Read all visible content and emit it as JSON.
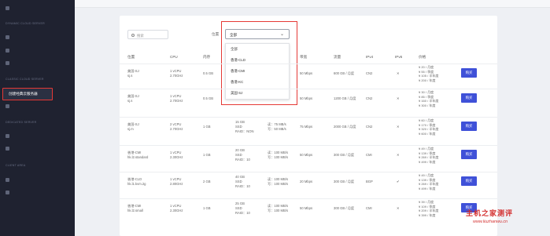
{
  "sidebar": {
    "active_item": "创建经典云服务器",
    "sections": [
      "DYNAMIC CLOUD SERVER",
      "CLASSIC CLOUD SERVER",
      "DEDICATED SERVER",
      "CLIENT AREA"
    ]
  },
  "header": {},
  "filters": {
    "search_placeholder": "搜索",
    "location_label": "位置",
    "location_value": "全部",
    "location_options": [
      "全部",
      "香港-CLD",
      "香港-CMI",
      "香港-KC",
      "美国-SJ"
    ]
  },
  "table": {
    "columns": [
      "位置",
      "CPU",
      "内存",
      "带宽",
      "流量",
      "IPv4",
      "IPv6",
      "价格"
    ],
    "buy_label": "购买",
    "rows": [
      {
        "loc": [
          "美国-SJ",
          "sj.s"
        ],
        "cpu": [
          "1 vCPU",
          "2.70GHz"
        ],
        "mem": "0.5 GB",
        "bw": "50 Mbps",
        "traffic": "600 GB / 月度",
        "ipv4": "CN2",
        "ipv6": "✕",
        "price": [
          "¥ 20 / 月度",
          "¥ 55 / 季度",
          "¥ 105 / 半年度",
          "¥ 200 / 年度"
        ]
      },
      {
        "loc": [
          "美国-SJ",
          "sj.s"
        ],
        "cpu": [
          "1 vCPU",
          "2.70GHz"
        ],
        "mem": "0.5 GB",
        "bw": "50 Mbps",
        "traffic": "1200 GB / 月度",
        "ipv4": "CN2",
        "ipv6": "✕",
        "price": [
          "¥ 30 / 月度",
          "¥ 85 / 季度",
          "¥ 160 / 半年度",
          "¥ 300 / 年度"
        ]
      },
      {
        "loc": [
          "美国-SJ",
          "sj.m"
        ],
        "cpu": [
          "2 vCPU",
          "2.70GHz"
        ],
        "mem": "1 GB",
        "disk": [
          "15 GB",
          "SSD",
          "RAID：NON"
        ],
        "io": [
          "读：75 MB/s",
          "写：50 MB/s"
        ],
        "bw": "75 Mbps",
        "traffic": "2000 GB / 月度",
        "ipv4": "CN2",
        "ipv6": "✕",
        "price": [
          "¥ 60 / 月度",
          "¥ 170 / 季度",
          "¥ 320 / 半年度",
          "¥ 600 / 年度"
        ]
      },
      {
        "loc": [
          "香港-CMI",
          "hk.l2.standard"
        ],
        "cpu": [
          "1 vCPU",
          "2.30GHz"
        ],
        "mem": "1 GB",
        "disk": [
          "20 GB",
          "SSD",
          "RAID：10"
        ],
        "io": [
          "读：100 MB/s",
          "写：100 MB/s"
        ],
        "bw": "50 Mbps",
        "traffic": "300 GB / 月度",
        "ipv4": "CMI",
        "ipv6": "✕",
        "price": [
          "¥ 49 / 月度",
          "¥ 139 / 季度",
          "¥ 269 / 半年度",
          "¥ 499 / 年度"
        ]
      },
      {
        "loc": [
          "香港-CLD",
          "hk.l1.kvm.2g"
        ],
        "cpu": [
          "1 vCPU",
          "2.80GHz"
        ],
        "mem": "2 GB",
        "disk": [
          "40 GB",
          "SSD",
          "RAID：10"
        ],
        "io": [
          "读：100 MB/s",
          "写：100 MB/s"
        ],
        "bw": "20 Mbps",
        "traffic": "300 GB / 月度",
        "ipv4": "BGP",
        "ipv6": "✔",
        "price": [
          "¥ 49 / 月度",
          "¥ 139 / 季度",
          "¥ 269 / 半年度",
          "¥ 499 / 年度"
        ]
      },
      {
        "loc": [
          "香港-CMI",
          "hk.l2.small"
        ],
        "cpu": [
          "1 vCPU",
          "2.30GHz"
        ],
        "mem": "1 GB",
        "disk": [
          "25 GB",
          "SSD",
          "RAID：10"
        ],
        "io": [
          "读：100 MB/s",
          "写：100 MB/s"
        ],
        "bw": "50 Mbps",
        "traffic": "300 GB / 月度",
        "ipv4": "CMI",
        "ipv6": "✕",
        "price": [
          "¥ 39 / 月度",
          "¥ 109 / 季度",
          "¥ 209 / 半年度",
          "¥ 399 / 年度"
        ]
      }
    ]
  },
  "watermark": {
    "title": "主机之家测评",
    "url": "www.liuzhanwu.cn"
  },
  "colors": {
    "sidebar_bg": "#1f2230",
    "accent": "#3f51d8",
    "highlight": "#e53935"
  }
}
